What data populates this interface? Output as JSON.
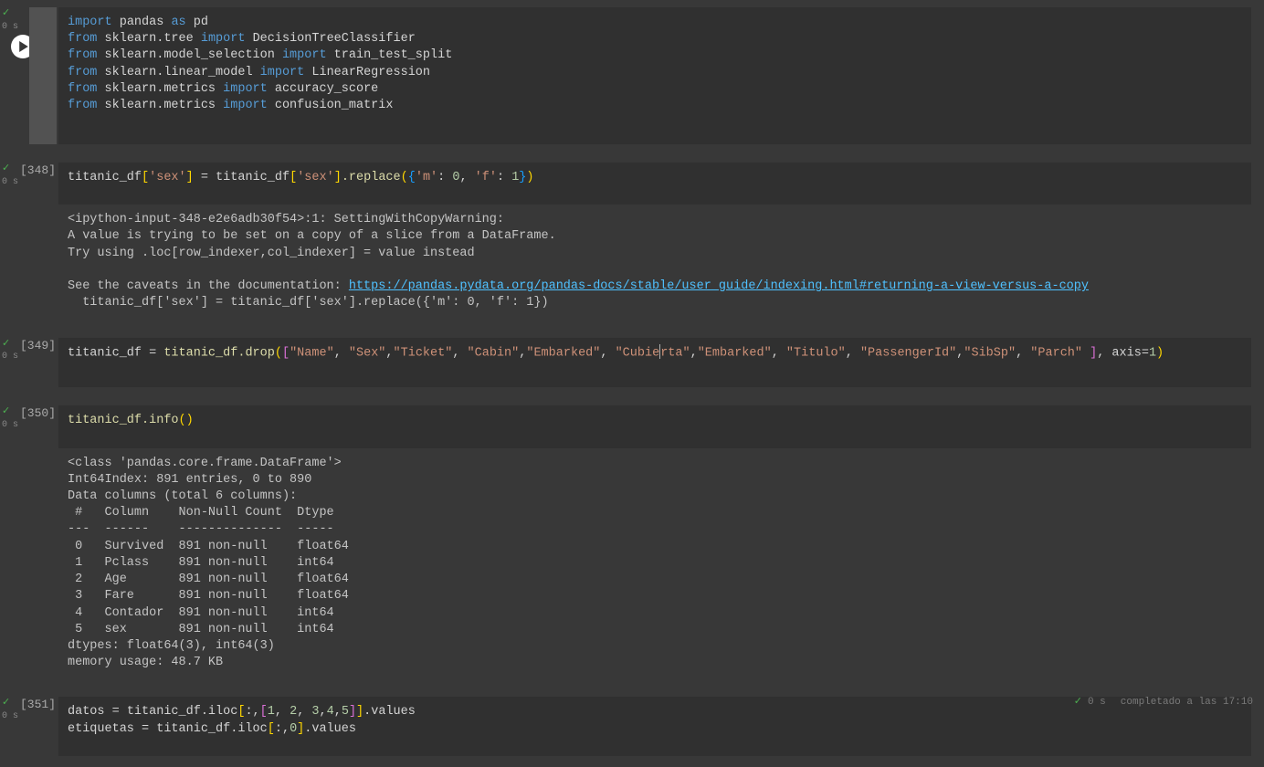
{
  "gutter": {
    "exec_time": "0 s"
  },
  "status_bar": {
    "runtime": "0 s",
    "completed": "completado a las 17:10"
  },
  "cells": {
    "c0": {
      "label": "",
      "code_lines": [
        [
          [
            "import ",
            "tok-kw"
          ],
          [
            "pandas ",
            "tok-id"
          ],
          [
            "as ",
            "tok-kw"
          ],
          [
            "pd",
            "tok-id"
          ]
        ],
        [
          [
            "from ",
            "tok-kw"
          ],
          [
            "sklearn.tree ",
            "tok-id"
          ],
          [
            "import ",
            "tok-kw"
          ],
          [
            "DecisionTreeClassifier",
            "tok-id"
          ]
        ],
        [
          [
            "from ",
            "tok-kw"
          ],
          [
            "sklearn.model_selection ",
            "tok-id"
          ],
          [
            "import ",
            "tok-kw"
          ],
          [
            "train_test_split",
            "tok-id"
          ]
        ],
        [
          [
            "from ",
            "tok-kw"
          ],
          [
            "sklearn.linear_model ",
            "tok-id"
          ],
          [
            "import ",
            "tok-kw"
          ],
          [
            "LinearRegression",
            "tok-id"
          ]
        ],
        [
          [
            "from ",
            "tok-kw"
          ],
          [
            "sklearn.metrics ",
            "tok-id"
          ],
          [
            "import ",
            "tok-kw"
          ],
          [
            "accuracy_score",
            "tok-id"
          ]
        ],
        [
          [
            "from ",
            "tok-kw"
          ],
          [
            "sklearn.metrics ",
            "tok-id"
          ],
          [
            "import ",
            "tok-kw"
          ],
          [
            "confusion_matrix",
            "tok-id"
          ]
        ]
      ]
    },
    "c1": {
      "label": "[348]",
      "code_lines": [
        [
          [
            "titanic_df",
            "tok-id"
          ],
          [
            "[",
            "tok-paren"
          ],
          [
            "'sex'",
            "tok-str"
          ],
          [
            "]",
            "tok-paren"
          ],
          [
            " = ",
            "tok-op"
          ],
          [
            "titanic_df",
            "tok-id"
          ],
          [
            "[",
            "tok-paren"
          ],
          [
            "'sex'",
            "tok-str"
          ],
          [
            "]",
            "tok-paren"
          ],
          [
            ".replace",
            "tok-fn"
          ],
          [
            "(",
            "tok-paren"
          ],
          [
            "{",
            "tok-brace"
          ],
          [
            "'m'",
            "tok-str"
          ],
          [
            ": ",
            "tok-op"
          ],
          [
            "0",
            "tok-num"
          ],
          [
            ", ",
            "tok-op"
          ],
          [
            "'f'",
            "tok-str"
          ],
          [
            ": ",
            "tok-op"
          ],
          [
            "1",
            "tok-num"
          ],
          [
            "}",
            "tok-brace"
          ],
          [
            ")",
            "tok-paren"
          ]
        ]
      ],
      "output_pre": "<ipython-input-348-e2e6adb30f54>:1: SettingWithCopyWarning: \nA value is trying to be set on a copy of a slice from a DataFrame.\nTry using .loc[row_indexer,col_indexer] = value instead\n\nSee the caveats in the documentation: ",
      "output_link": "https://pandas.pydata.org/pandas-docs/stable/user_guide/indexing.html#returning-a-view-versus-a-copy",
      "output_post": "\n  titanic_df['sex'] = titanic_df['sex'].replace({'m': 0, 'f': 1})"
    },
    "c2": {
      "label": "[349]",
      "code_lines": [
        [
          [
            "titanic_df ",
            "tok-id"
          ],
          [
            "= ",
            "tok-op"
          ],
          [
            "titanic_df.drop",
            "tok-fn"
          ],
          [
            "(",
            "tok-paren"
          ],
          [
            "[",
            "tok-bracket"
          ],
          [
            "\"Name\"",
            "tok-str"
          ],
          [
            ", ",
            "tok-op"
          ],
          [
            "\"Sex\"",
            "tok-str"
          ],
          [
            ",",
            "tok-op"
          ],
          [
            "\"Ticket\"",
            "tok-str"
          ],
          [
            ", ",
            "tok-op"
          ],
          [
            "\"Cabin\"",
            "tok-str"
          ],
          [
            ",",
            "tok-op"
          ],
          [
            "\"Embarked\"",
            "tok-str"
          ],
          [
            ", ",
            "tok-op"
          ],
          [
            "\"Cubie",
            "tok-str"
          ],
          [
            "__CURSOR__",
            ""
          ],
          [
            "rta\"",
            "tok-str"
          ],
          [
            ",",
            "tok-op"
          ],
          [
            "\"Embarked\"",
            "tok-str"
          ],
          [
            ", ",
            "tok-op"
          ],
          [
            "\"Titulo\"",
            "tok-str"
          ],
          [
            ", ",
            "tok-op"
          ],
          [
            "\"PassengerId\"",
            "tok-str"
          ],
          [
            ",",
            "tok-op"
          ],
          [
            "\"SibSp\"",
            "tok-str"
          ],
          [
            ", ",
            "tok-op"
          ],
          [
            "\"Parch\" ",
            "tok-str"
          ],
          [
            "]",
            "tok-bracket"
          ],
          [
            ", axis=",
            "tok-op"
          ],
          [
            "1",
            "tok-num"
          ],
          [
            ")",
            "tok-paren"
          ]
        ]
      ]
    },
    "c3": {
      "label": "[350]",
      "code_lines": [
        [
          [
            "titanic_df.info",
            "tok-fn"
          ],
          [
            "()",
            "tok-paren"
          ]
        ]
      ],
      "output": "<class 'pandas.core.frame.DataFrame'>\nInt64Index: 891 entries, 0 to 890\nData columns (total 6 columns):\n #   Column    Non-Null Count  Dtype  \n---  ------    --------------  -----  \n 0   Survived  891 non-null    float64\n 1   Pclass    891 non-null    int64  \n 2   Age       891 non-null    float64\n 3   Fare      891 non-null    float64\n 4   Contador  891 non-null    int64  \n 5   sex       891 non-null    int64  \ndtypes: float64(3), int64(3)\nmemory usage: 48.7 KB"
    },
    "c4": {
      "label": "[351]",
      "code_lines": [
        [
          [
            "datos ",
            "tok-id"
          ],
          [
            "= ",
            "tok-op"
          ],
          [
            "titanic_df.iloc",
            "tok-id"
          ],
          [
            "[",
            "tok-paren"
          ],
          [
            ":,",
            "tok-op"
          ],
          [
            "[",
            "tok-bracket"
          ],
          [
            "1",
            "tok-num"
          ],
          [
            ", ",
            "tok-op"
          ],
          [
            "2",
            "tok-num"
          ],
          [
            ", ",
            "tok-op"
          ],
          [
            "3",
            "tok-num"
          ],
          [
            ",",
            "tok-op"
          ],
          [
            "4",
            "tok-num"
          ],
          [
            ",",
            "tok-op"
          ],
          [
            "5",
            "tok-num"
          ],
          [
            "]",
            "tok-bracket"
          ],
          [
            "]",
            "tok-paren"
          ],
          [
            ".values",
            "tok-id"
          ]
        ],
        [
          [
            "etiquetas ",
            "tok-id"
          ],
          [
            "= ",
            "tok-op"
          ],
          [
            "titanic_df.iloc",
            "tok-id"
          ],
          [
            "[",
            "tok-paren"
          ],
          [
            ":,",
            "tok-op"
          ],
          [
            "0",
            "tok-num"
          ],
          [
            "]",
            "tok-paren"
          ],
          [
            ".values",
            "tok-id"
          ]
        ]
      ]
    }
  }
}
